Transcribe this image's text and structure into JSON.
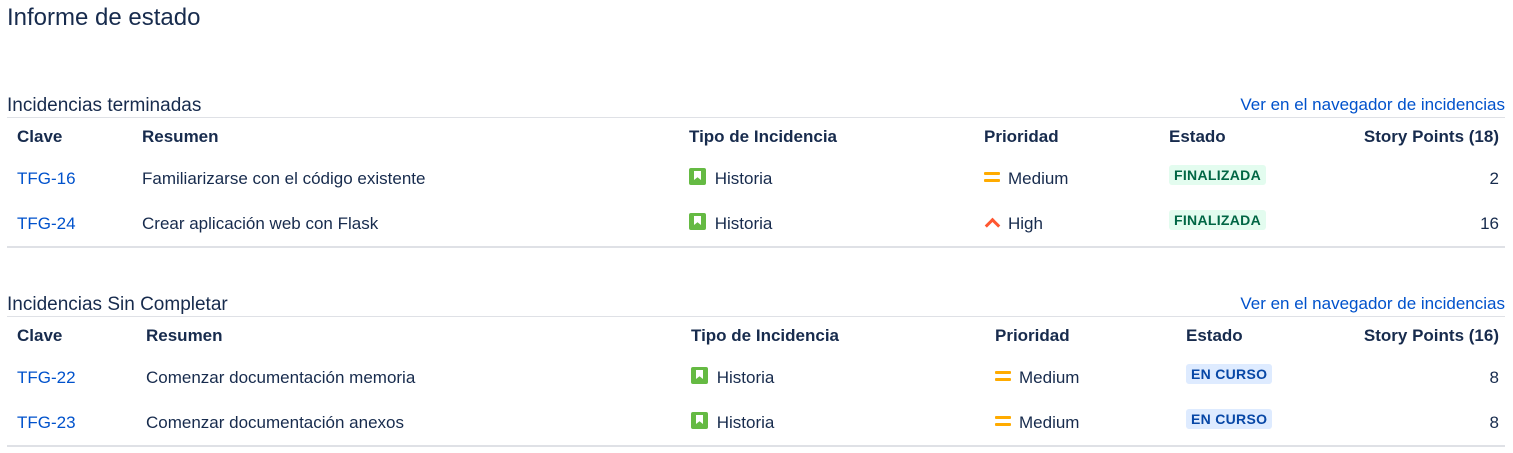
{
  "page_title": "Informe de estado",
  "colors": {
    "link": "#0052cc",
    "done_bg": "#e3fcef",
    "done_text": "#006644",
    "progress_bg": "#deebff",
    "progress_text": "#0747a6",
    "story_icon": "#65ba43",
    "priority_medium": "#ffab00",
    "priority_high": "#ff5630"
  },
  "completed": {
    "title": "Incidencias terminadas",
    "link": "Ver en el navegador de incidencias",
    "headers": {
      "key": "Clave",
      "summary": "Resumen",
      "type": "Tipo de Incidencia",
      "priority": "Prioridad",
      "status": "Estado",
      "points": "Story Points (18)"
    },
    "rows": [
      {
        "key": "TFG-16",
        "summary": "Familiarizarse con el código existente",
        "type": "Historia",
        "type_icon": "story-icon",
        "priority": "Medium",
        "priority_icon": "priority-medium-icon",
        "status": "FINALIZADA",
        "points": "2"
      },
      {
        "key": "TFG-24",
        "summary": "Crear aplicación web con Flask",
        "type": "Historia",
        "type_icon": "story-icon",
        "priority": "High",
        "priority_icon": "priority-high-icon",
        "status": "FINALIZADA",
        "points": "16"
      }
    ]
  },
  "incomplete": {
    "title": "Incidencias Sin Completar",
    "link": "Ver en el navegador de incidencias",
    "headers": {
      "key": "Clave",
      "summary": "Resumen",
      "type": "Tipo de Incidencia",
      "priority": "Prioridad",
      "status": "Estado",
      "points": "Story Points (16)"
    },
    "rows": [
      {
        "key": "TFG-22",
        "summary": "Comenzar documentación memoria",
        "type": "Historia",
        "type_icon": "story-icon",
        "priority": "Medium",
        "priority_icon": "priority-medium-icon",
        "status": "EN CURSO",
        "points": "8"
      },
      {
        "key": "TFG-23",
        "summary": "Comenzar documentación anexos",
        "type": "Historia",
        "type_icon": "story-icon",
        "priority": "Medium",
        "priority_icon": "priority-medium-icon",
        "status": "EN CURSO",
        "points": "8"
      }
    ]
  }
}
